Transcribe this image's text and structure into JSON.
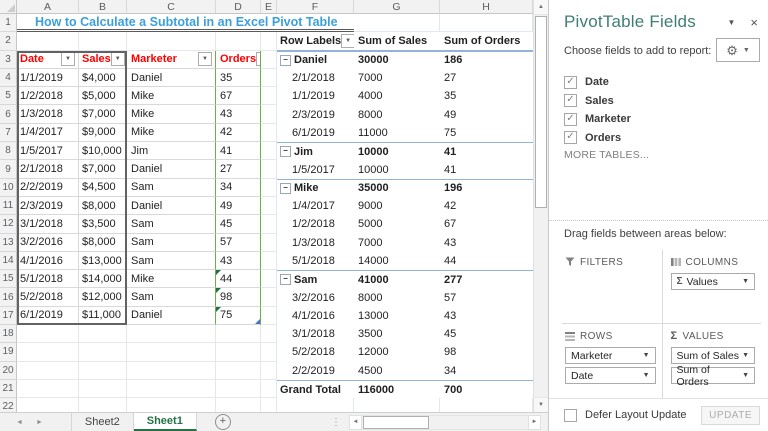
{
  "colors": {
    "accent_green": "#217346",
    "title_blue": "#3BA0DB",
    "header_red": "#FE0000",
    "pivot_border_blue": "#95B3D7",
    "table_green_border": "#70AD47",
    "panel_title_teal": "#3E7E72"
  },
  "icons": {
    "dropdown": "▼",
    "collapse": "−",
    "gear": "⚙",
    "close": "×",
    "pane_caret": "▼",
    "up": "▲",
    "down": "▼",
    "left": "◄",
    "right": "►",
    "plus": "+",
    "check": "✓",
    "gripper": "⋮",
    "sigma": "Σ"
  },
  "sheet": {
    "title": "How to Calculate a Subtotal in an Excel Pivot Table",
    "column_letters": [
      "A",
      "B",
      "C",
      "D",
      "E",
      "F",
      "G",
      "H"
    ],
    "visible_rows": 22,
    "table": {
      "headers": [
        "Date",
        "Sales",
        "Marketer",
        "Orders"
      ],
      "rows": [
        [
          "1/1/2019",
          "$4,000",
          "Daniel",
          "35"
        ],
        [
          "1/2/2018",
          "$5,000",
          "Mike",
          "67"
        ],
        [
          "1/3/2018",
          "$7,000",
          "Mike",
          "43"
        ],
        [
          "1/4/2017",
          "$9,000",
          "Mike",
          "42"
        ],
        [
          "1/5/2017",
          "$10,000",
          "Jim",
          "41"
        ],
        [
          "2/1/2018",
          "$7,000",
          "Daniel",
          "27"
        ],
        [
          "2/2/2019",
          "$4,500",
          "Sam",
          "34"
        ],
        [
          "2/3/2019",
          "$8,000",
          "Daniel",
          "49"
        ],
        [
          "3/1/2018",
          "$3,500",
          "Sam",
          "45"
        ],
        [
          "3/2/2016",
          "$8,000",
          "Sam",
          "57"
        ],
        [
          "4/1/2016",
          "$13,000",
          "Sam",
          "43"
        ],
        [
          "5/1/2018",
          "$14,000",
          "Mike",
          "44"
        ],
        [
          "5/2/2018",
          "$12,000",
          "Sam",
          "98"
        ],
        [
          "6/1/2019",
          "$11,000",
          "Daniel",
          "75"
        ]
      ],
      "error_marker_rows": [
        15,
        16,
        17
      ]
    },
    "pivot": {
      "headers": [
        "Row Labels",
        "Sum of Sales",
        "Sum of Orders"
      ],
      "rows": [
        {
          "t": "group",
          "label": "Daniel",
          "sales": "30000",
          "orders": "186"
        },
        {
          "t": "detail",
          "label": "2/1/2018",
          "sales": "7000",
          "orders": "27"
        },
        {
          "t": "detail",
          "label": "1/1/2019",
          "sales": "4000",
          "orders": "35"
        },
        {
          "t": "detail",
          "label": "2/3/2019",
          "sales": "8000",
          "orders": "49"
        },
        {
          "t": "detail",
          "label": "6/1/2019",
          "sales": "11000",
          "orders": "75"
        },
        {
          "t": "group",
          "label": "Jim",
          "sales": "10000",
          "orders": "41"
        },
        {
          "t": "detail",
          "label": "1/5/2017",
          "sales": "10000",
          "orders": "41"
        },
        {
          "t": "group",
          "label": "Mike",
          "sales": "35000",
          "orders": "196"
        },
        {
          "t": "detail",
          "label": "1/4/2017",
          "sales": "9000",
          "orders": "42"
        },
        {
          "t": "detail",
          "label": "1/2/2018",
          "sales": "5000",
          "orders": "67"
        },
        {
          "t": "detail",
          "label": "1/3/2018",
          "sales": "7000",
          "orders": "43"
        },
        {
          "t": "detail",
          "label": "5/1/2018",
          "sales": "14000",
          "orders": "44"
        },
        {
          "t": "group",
          "label": "Sam",
          "sales": "41000",
          "orders": "277"
        },
        {
          "t": "detail",
          "label": "3/2/2016",
          "sales": "8000",
          "orders": "57"
        },
        {
          "t": "detail",
          "label": "4/1/2016",
          "sales": "13000",
          "orders": "43"
        },
        {
          "t": "detail",
          "label": "3/1/2018",
          "sales": "3500",
          "orders": "45"
        },
        {
          "t": "detail",
          "label": "5/2/2018",
          "sales": "12000",
          "orders": "98"
        },
        {
          "t": "detail",
          "label": "2/2/2019",
          "sales": "4500",
          "orders": "34"
        },
        {
          "t": "total",
          "label": "Grand Total",
          "sales": "116000",
          "orders": "700"
        }
      ]
    },
    "tabs": {
      "sheet2": "Sheet2",
      "sheet1": "Sheet1"
    }
  },
  "panel": {
    "title": "PivotTable Fields",
    "choose_label": "Choose fields to add to report:",
    "fields": [
      {
        "label": "Date",
        "checked": true
      },
      {
        "label": "Sales",
        "checked": true
      },
      {
        "label": "Marketer",
        "checked": true
      },
      {
        "label": "Orders",
        "checked": true
      }
    ],
    "more_tables": "MORE TABLES...",
    "drag_label": "Drag fields between areas below:",
    "areas": {
      "filters": {
        "label": "FILTERS",
        "items": []
      },
      "columns": {
        "label": "COLUMNS",
        "items": [
          "Values"
        ]
      },
      "rows": {
        "label": "ROWS",
        "items": [
          "Marketer",
          "Date"
        ]
      },
      "values": {
        "label": "VALUES",
        "items": [
          "Sum of Sales",
          "Sum of Orders"
        ]
      }
    },
    "defer_label": "Defer Layout Update",
    "update_label": "UPDATE"
  }
}
